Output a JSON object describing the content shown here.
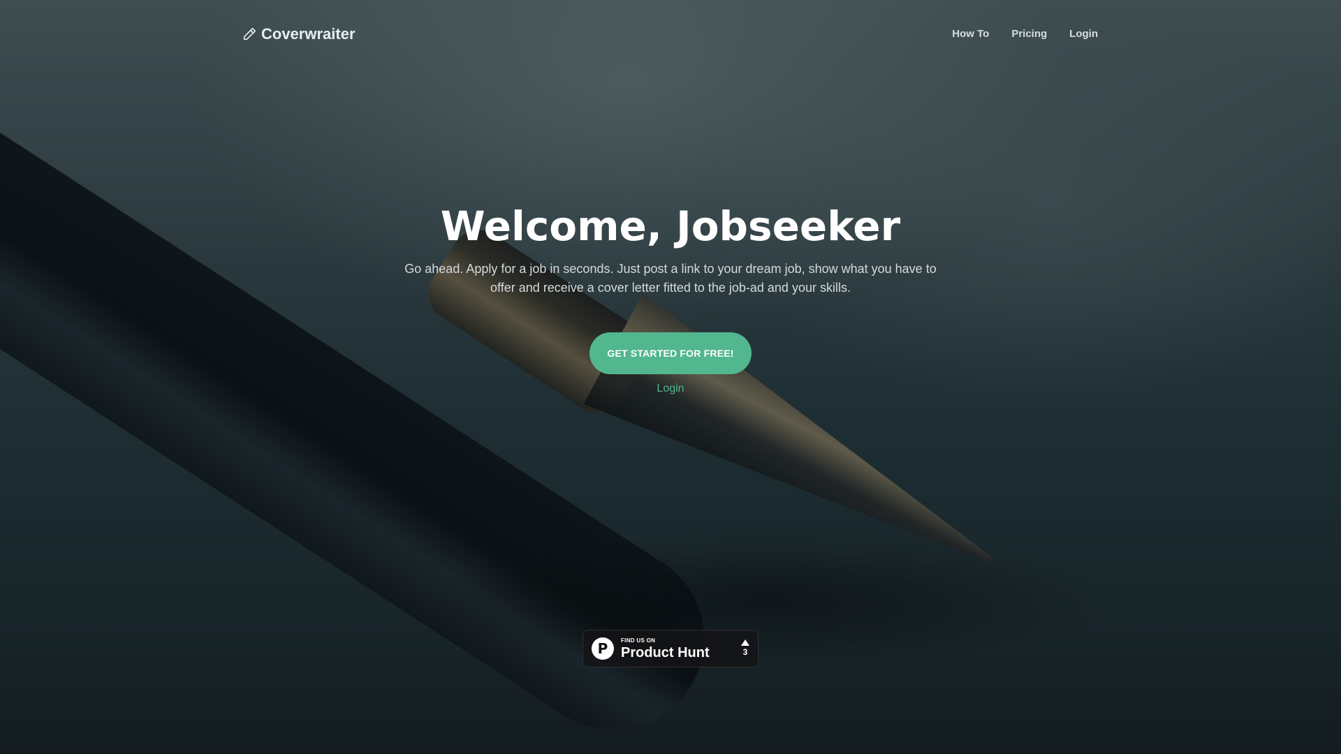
{
  "brand": {
    "name": "Coverwraiter",
    "icon": "pencil-icon"
  },
  "nav": {
    "links": [
      {
        "label": "How To"
      },
      {
        "label": "Pricing"
      },
      {
        "label": "Login"
      }
    ]
  },
  "hero": {
    "title": "Welcome, Jobseeker",
    "subtitle": "Go ahead. Apply for a job in seconds. Just post a link to your dream job, show what you have to offer and receive a cover letter fitted to the job-ad and your skills.",
    "cta_label": "GET STARTED FOR FREE!",
    "login_label": "Login"
  },
  "product_hunt": {
    "small_text": "FIND US ON",
    "big_text": "Product Hunt",
    "logo_letter": "P",
    "votes": "3"
  },
  "colors": {
    "accent": "#52b78f",
    "text_primary": "#ffffff",
    "nav_text": "#d6dde0"
  }
}
